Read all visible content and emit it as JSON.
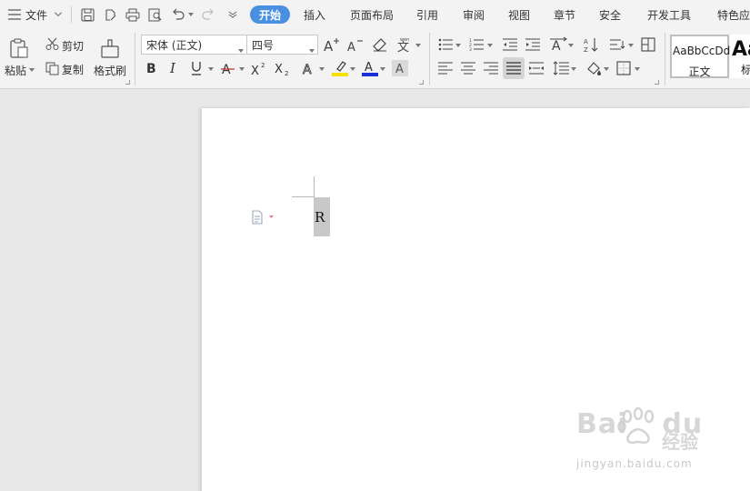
{
  "menubar": {
    "file": "文件",
    "tabs": [
      "开始",
      "插入",
      "页面布局",
      "引用",
      "审阅",
      "视图",
      "章节",
      "安全",
      "开发工具",
      "特色应"
    ],
    "active_tab": "开始",
    "accent_color": "#4a90e2"
  },
  "ribbon": {
    "paste": "粘贴",
    "cut": "剪切",
    "copy": "复制",
    "format_painter": "格式刷",
    "font_name": "宋体 (正文)",
    "font_size": "四号",
    "style_preview_text": "AaBbCcDd",
    "style_normal_label": "正文",
    "style_next_preview": "Aa",
    "style_next_label": "标"
  },
  "document": {
    "selected_text": "R"
  },
  "watermark": {
    "brand_part1": "Bai",
    "brand_part2": "du",
    "brand_cn": "经验",
    "url": "jingyan.baidu.com"
  },
  "icons": [
    "hamburger-icon",
    "save-icon",
    "save-as-icon",
    "print-icon",
    "print-preview-icon",
    "undo-icon",
    "redo-icon",
    "more-icon",
    "paste-icon",
    "cut-icon",
    "copy-icon",
    "format-painter-icon",
    "increase-font-icon",
    "decrease-font-icon",
    "clear-format-icon",
    "phonetic-icon",
    "bold-icon",
    "italic-icon",
    "underline-icon",
    "strikethrough-icon",
    "superscript-icon",
    "subscript-icon",
    "text-effect-icon",
    "highlight-icon",
    "font-color-icon",
    "char-shading-icon",
    "bullets-icon",
    "numbering-icon",
    "decrease-indent-icon",
    "increase-indent-icon",
    "chinese-layout-icon",
    "sort-icon",
    "line-options-icon",
    "show-marks-icon",
    "align-left-icon",
    "align-center-icon",
    "align-right-icon",
    "justify-icon",
    "distribute-icon",
    "line-spacing-icon",
    "shading-icon",
    "borders-icon",
    "paste-options-icon"
  ]
}
